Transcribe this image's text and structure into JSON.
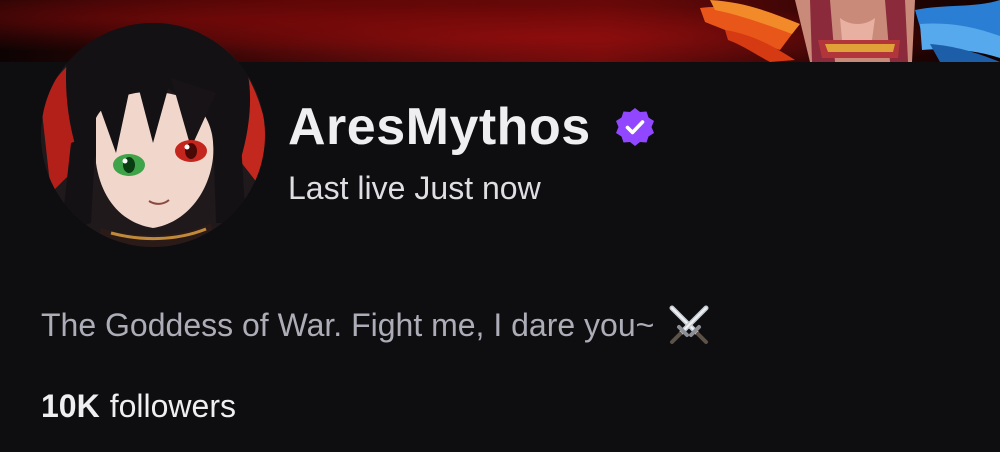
{
  "channel": {
    "name": "AresMythos",
    "verified": true,
    "last_live_prefix": "Last live",
    "last_live_value": "Just now",
    "bio_text": "The Goddess of War. Fight me, I dare you~",
    "bio_emoji": "crossed-swords-icon",
    "followers_count": "10K",
    "followers_label": "followers"
  },
  "colors": {
    "background": "#0e0e10",
    "verified_badge": "#9147ff",
    "banner_red": "#6e0b0b",
    "text_primary": "#efeff1",
    "text_secondary": "#adadb8"
  }
}
